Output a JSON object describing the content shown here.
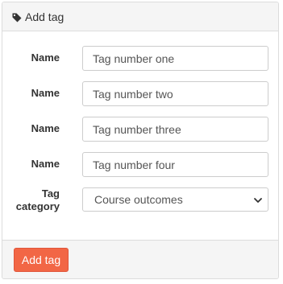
{
  "header": {
    "icon": "tag-icon",
    "title": "Add tag"
  },
  "form": {
    "fields": [
      {
        "label": "Name",
        "value": "Tag number one"
      },
      {
        "label": "Name",
        "value": "Tag number two"
      },
      {
        "label": "Name",
        "value": "Tag number three"
      },
      {
        "label": "Name",
        "value": "Tag number four"
      }
    ],
    "category": {
      "label_line1": "Tag",
      "label_line2": "category",
      "selected": "Course outcomes",
      "icon": "chevron-down-icon"
    }
  },
  "footer": {
    "submit_label": "Add tag"
  },
  "colors": {
    "accent": "#f26645",
    "header_bg": "#f5f5f5",
    "border": "#dcdcdc"
  }
}
